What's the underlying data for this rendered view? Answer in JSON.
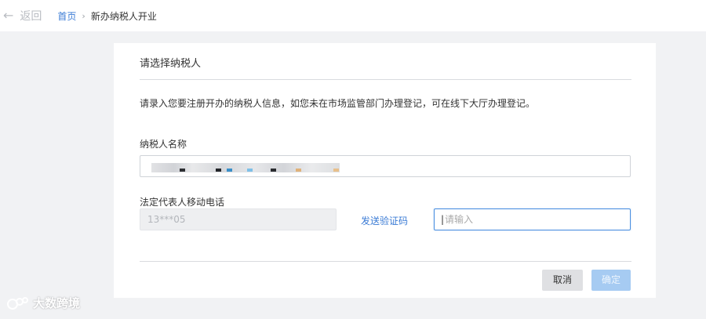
{
  "topbar": {
    "back_label": "返回",
    "breadcrumb_home": "首页",
    "breadcrumb_separator": "›",
    "breadcrumb_current": "新办纳税人开业"
  },
  "form": {
    "section_title": "请选择纳税人",
    "notice": "请录入您要注册开办的纳税人信息，如您未在市场监管部门办理登记，可在线下大厅办理登记。",
    "taxpayer_name_label": "纳税人名称",
    "legal_rep_phone_label": "法定代表人移动电话",
    "phone_value": "13***05",
    "send_code_label": "发送验证码",
    "code_placeholder": "请输入",
    "cancel_label": "取消",
    "confirm_label": "确定"
  },
  "watermark": {
    "text": "大数跨境"
  },
  "colors": {
    "link": "#3a7bd5",
    "focus_border": "#4a8fe0",
    "confirm_disabled_bg": "#a6cbf2",
    "cancel_bg": "#dfe0e3"
  }
}
